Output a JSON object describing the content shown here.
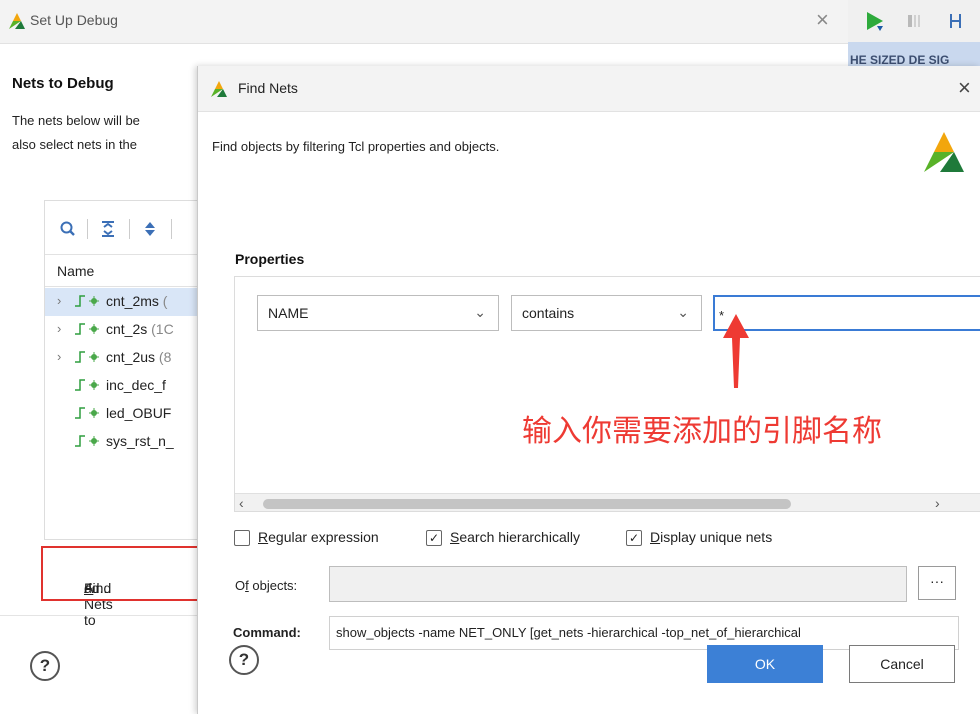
{
  "back_dialog": {
    "title": "Set Up Debug",
    "close_glyph": "×",
    "heading": "Nets to Debug",
    "desc_line1": "The nets below will be",
    "desc_line2": "also select nets in the",
    "toolbar_icons": [
      "search-icon",
      "collapse-all-icon",
      "expand-icon"
    ],
    "column_header": "Name",
    "nets": [
      {
        "chevron": "›",
        "name": "cnt_2ms",
        "suffix": " (",
        "selected": true
      },
      {
        "chevron": "›",
        "name": "cnt_2s",
        "suffix": " (1C",
        "selected": false
      },
      {
        "chevron": "›",
        "name": "cnt_2us",
        "suffix": " (8",
        "selected": false
      },
      {
        "chevron": "",
        "name": "inc_dec_f",
        "suffix": "",
        "selected": false
      },
      {
        "chevron": "",
        "name": "led_OBUF",
        "suffix": "",
        "selected": false
      },
      {
        "chevron": "",
        "name": "sys_rst_n_",
        "suffix": "",
        "selected": false
      }
    ],
    "find_nets_button": {
      "before": "Find Nets to ",
      "mnemonic": "A",
      "after": "dd..."
    },
    "help": "?"
  },
  "right_strip": {
    "band_text": "HE SIZED DE SIG"
  },
  "find_nets_dialog": {
    "title": "Find Nets",
    "close_glyph": "×",
    "description": "Find objects by filtering Tcl properties and objects.",
    "properties_label": "Properties",
    "property_combo": "NAME",
    "operator_combo": "contains",
    "combo_chevron": "⌄",
    "value_input": "*",
    "annotation": "输入你需要添加的引脚名称",
    "annotation_color": "#ee3a33",
    "scroll_left": "‹",
    "scroll_right": "›",
    "checkboxes": [
      {
        "mnemonic": "R",
        "rest": "egular expression",
        "checked": false
      },
      {
        "mnemonic": "S",
        "rest": "earch hierarchically",
        "checked": true
      },
      {
        "mnemonic": "D",
        "rest": "isplay unique nets",
        "checked": true
      }
    ],
    "of_objects_label": {
      "before": "O",
      "mnemonic": "f",
      "after": " objects:"
    },
    "of_objects_button": "···",
    "command_label": "Command:",
    "command_value": "show_objects -name NET_ONLY [get_nets -hierarchical -top_net_of_hierarchical",
    "ok_label": "OK",
    "cancel_label": "Cancel",
    "help": "?",
    "accent_color": "#3c80d6"
  }
}
